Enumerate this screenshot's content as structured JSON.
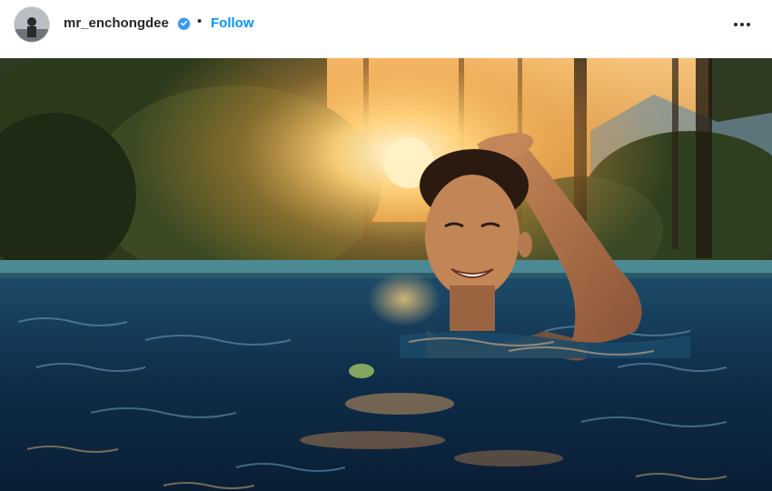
{
  "post": {
    "username": "mr_enchongdee",
    "separator": "•",
    "follow_label": "Follow",
    "verified_icon": "verified-badge-icon",
    "more_icon": "more-options-icon",
    "accent_color": "#0095f6",
    "verified_color": "#3897f0"
  },
  "photo": {
    "subject": "pool-sunset-photo"
  }
}
